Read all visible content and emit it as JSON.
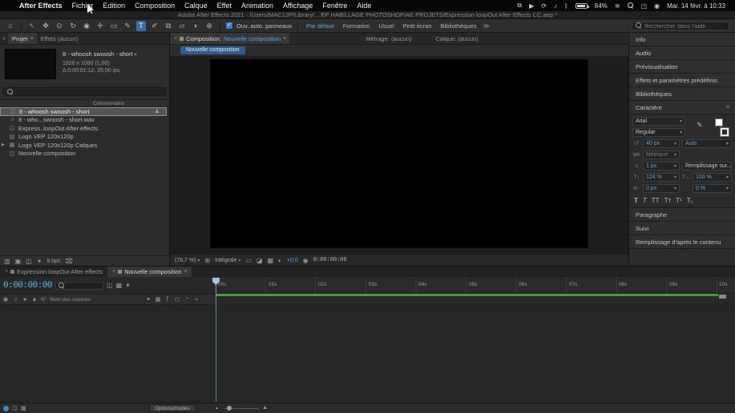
{
  "menu_bar": {
    "items": [
      "After Effects",
      "Fichier",
      "Edition",
      "Composition",
      "Calque",
      "Effet",
      "Animation",
      "Affichage",
      "Fenêtre",
      "Aide"
    ],
    "battery": "84%",
    "clock": "Mar. 14 févr. à 10:33"
  },
  "title_bar": {
    "title": "Adobe After Effects 2021 - /Users/MAC12P/Library/... EP HABILLAGE PHOTOSHOP/AE PROJETS/Expression loopOut After Effects CC.aep *"
  },
  "toolbar": {
    "auto_open_label": "Ouv. auto. panneaux",
    "workspaces": [
      "Par défaut",
      "Formation",
      "Usuel",
      "Petit écran",
      "Bibliothèques"
    ],
    "search_placeholder": "Rechercher dans l'aide"
  },
  "project_panel": {
    "tab_project": "Projet",
    "tab_effects": "Effets (aucun)",
    "preview_name": "8 - whoosh swoosh - short",
    "preview_dims": "1920 x 1080 (1,00)",
    "preview_duration": "Δ 0:00:01:12, 25,00 ips",
    "column_comment": "Commentaire",
    "items": [
      "8 - whoosh swoosh - short",
      "8 - who...swoosh - short.wav",
      "Express..loopOut After effects",
      "Logo VEP 120x120p",
      "Logo VEP 120x120p Calques",
      "Nouvelle composition"
    ],
    "bpc": "8 bpc"
  },
  "comp_panel": {
    "tab_comp_prefix": "Composition:",
    "tab_comp_name": "Nouvelle composition",
    "tab_footage": "Métrage: (aucun)",
    "tab_layer": "Calque: (aucun)",
    "badge": "Nouvelle composition",
    "zoom": "(76,7 %)",
    "resolution": "Intégrale",
    "exposure": "+0,0",
    "timecode": "0:00:00:00"
  },
  "right_panels": {
    "headers_top": [
      "Info",
      "Audio",
      "Prévisualisation",
      "Effets et paramètres prédéfinis",
      "Bibliothèques"
    ],
    "character_title": "Caractère",
    "character": {
      "font_family": "Arial",
      "font_style": "Regular",
      "font_size": "40 px",
      "kerning": "Métrique",
      "kerning_auto": "Auto",
      "stroke_width": "1 px",
      "fill_mode": "Remplissage sur...",
      "vertical_scale": "124 %",
      "horizontal_scale": "100 %",
      "baseline_shift": "0 px",
      "tsume": "0 %"
    },
    "headers_bottom": [
      "Paragraphe",
      "Suivi",
      "Remplissage d'après le contenu"
    ]
  },
  "timeline": {
    "tab_inactive": "Expression loopOut After effects",
    "tab_active": "Nouvelle composition",
    "timecode": "0:00:00:00",
    "ruler": [
      "00s",
      "01s",
      "02s",
      "03s",
      "04s",
      "05s",
      "06s",
      "07s",
      "08s",
      "09s",
      "10s"
    ],
    "col_number": "N°",
    "col_source": "Nom des sources",
    "options_label": "Options/modes"
  }
}
